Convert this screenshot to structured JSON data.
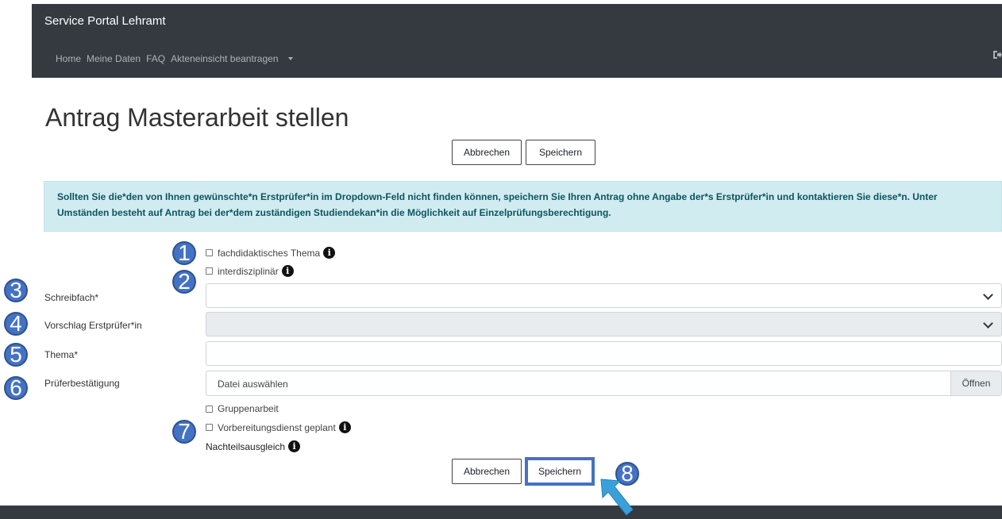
{
  "header": {
    "brand": "Service Portal Lehramt",
    "nav": [
      "Home",
      "Meine Daten",
      "FAQ",
      "Akteneinsicht beantragen"
    ],
    "logout_icon": "sign-out-icon"
  },
  "page": {
    "title": "Antrag Masterarbeit stellen"
  },
  "actions": {
    "cancel": "Abbrechen",
    "save": "Speichern"
  },
  "alert": {
    "text": "Sollten Sie die*den von Ihnen gewünschte*n Erstprüfer*in im Dropdown-Feld nicht finden können, speichern Sie Ihren Antrag ohne Angabe der*s Erstprüfer*in und kontaktieren Sie diese*n. Unter Umständen besteht auf Antrag bei der*dem zuständigen Studiendekan*in die Möglichkeit auf Einzelprüfungsberechtigung."
  },
  "form": {
    "fachdidaktisch": "fachdidaktisches Thema",
    "interdisziplinaer": "interdisziplinär",
    "schreibfach_label": "Schreibfach*",
    "schreibfach_value": "",
    "erstpruefer_label": "Vorschlag Erstprüfer*in",
    "erstpruefer_value": "",
    "thema_label": "Thema*",
    "thema_value": "",
    "pruefer_label": "Prüferbestätigung",
    "file_placeholder": "Datei auswählen",
    "file_button": "Öffnen",
    "gruppenarbeit": "Gruppenarbeit",
    "vorbereitungsdienst": "Vorbereitungsdienst geplant",
    "nachteilsausgleich": "Nachteilsausgleich"
  },
  "annotations": [
    "1",
    "2",
    "3",
    "4",
    "5",
    "6",
    "7",
    "8"
  ],
  "colors": {
    "navbar": "#343a40",
    "alert_bg": "#d1ecf1",
    "alert_text": "#0c5460",
    "annotation_blue": "#4472c4",
    "arrow": "#3aa0dc"
  }
}
